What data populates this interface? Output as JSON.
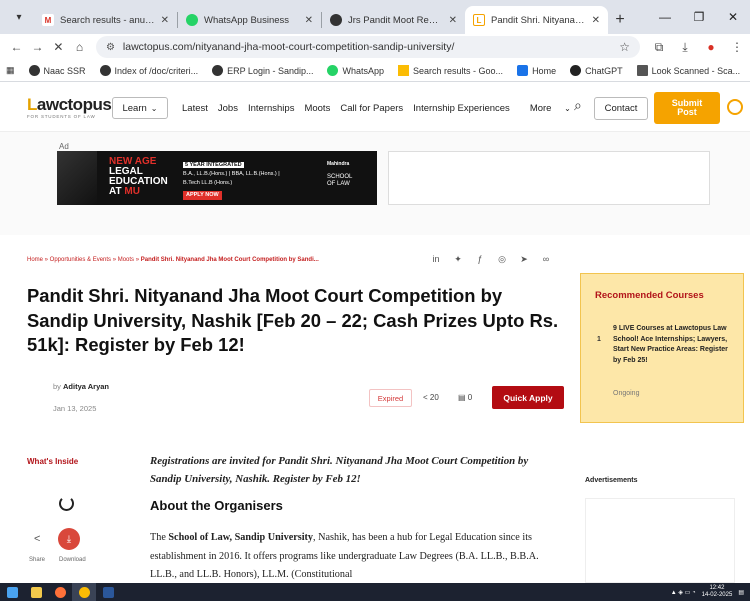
{
  "browser": {
    "tabs": [
      {
        "label": "Search results - anuja.nehe@s",
        "icon": "gmail-icon",
        "color": "#d93025"
      },
      {
        "label": "WhatsApp Business",
        "icon": "whatsapp-icon",
        "color": "#25d366"
      },
      {
        "label": "Jrs Pandit Moot Report",
        "icon": "doc-icon",
        "color": "#333333"
      },
      {
        "label": "Pandit Shri. Nityanand Jha Moo",
        "icon": "lawctopus-icon",
        "color": "#f5a300",
        "active": true
      }
    ],
    "url": "lawctopus.com/nityanand-jha-moot-court-competition-sandip-university/",
    "bookmarks": [
      {
        "label": "Naac SSR",
        "icon": "globe-icon",
        "color": "#333333"
      },
      {
        "label": "Index of /doc/criteri...",
        "icon": "globe-icon",
        "color": "#333333"
      },
      {
        "label": "ERP Login - Sandip...",
        "icon": "gear-icon",
        "color": "#333333"
      },
      {
        "label": "WhatsApp",
        "icon": "whatsapp-icon",
        "color": "#25d366"
      },
      {
        "label": "Search results - Goo...",
        "icon": "drive-icon",
        "color": "#fbbc04"
      },
      {
        "label": "Home",
        "icon": "home-icon",
        "color": "#1a73e8"
      },
      {
        "label": "ChatGPT",
        "icon": "chatgpt-icon",
        "color": "#222222"
      },
      {
        "label": "Look Scanned - Sca...",
        "icon": "scan-icon",
        "color": "#555555"
      },
      {
        "label": "M",
        "icon": "gmail-icon",
        "color": "#d93025"
      }
    ]
  },
  "site": {
    "logo_prefix": "L",
    "logo_rest": "awctopus",
    "logo_tag": "FOR STUDENTS OF LAW",
    "learn": "Learn",
    "nav": [
      "Latest",
      "Jobs",
      "Internships",
      "Moots",
      "Call for Papers",
      "Internship Experiences",
      "More"
    ],
    "contact": "Contact",
    "submit_line1": "Submit",
    "submit_line2": "Post"
  },
  "ad": {
    "label": "Ad",
    "line1": "NEW AGE",
    "line2": "LEGAL",
    "line3": "EDUCATION",
    "line4a": "AT ",
    "line4b": "MU",
    "badge": "5 YEAR INTEGRATED",
    "programs1": "B.A., LL.B.(Hons.) | BBA, LL.B.(Hons.) |",
    "programs2": "B.Tech LL.B (Hons.)",
    "apply": "APPLY NOW",
    "brand": "Mahindra",
    "school1": "SCHOOL",
    "school2": "OF LAW"
  },
  "article": {
    "breadcrumb_prefix": "Home » Opportunities & Events » Moots » ",
    "breadcrumb_current": "Pandit Shri. Nityanand Jha Moot Court Competition by Sandi...",
    "title": "Pandit Shri. Nityanand Jha Moot Court Competition by Sandip University, Nashik [Feb 20 – 22; Cash Prizes Upto Rs. 51k]: Register by Feb 12!",
    "by": "by ",
    "author": "Aditya Aryan",
    "date": "Jan 13, 2025",
    "status": "Expired",
    "shares": "20",
    "comments": "0",
    "cta": "Quick Apply",
    "whats_inside": "What's Inside",
    "share_label": "Share",
    "download_label": "Download",
    "lead": "Registrations are invited for Pandit Shri. Nityanand Jha Moot Court Competition by Sandip University, Nashik. Register by Feb 12!",
    "section_heading": "About the Organisers",
    "body_pre": "The ",
    "body_bold": "School of Law, Sandip University",
    "body_post": ", Nashik, has been a hub for Legal Education since its establishment in 2016. It offers programs like undergraduate Law Degrees (B.A. LL.B., B.B.A. LL.B., and LL.B. Honors), LL.M. (Constitutional"
  },
  "sidebar": {
    "rec_title": "Recommended Courses",
    "rec_num": "1",
    "rec_text": "9 LIVE Courses at Lawctopus Law School! Ace Internships; Lawyers, Start New Practice Areas: Register by Feb 25!",
    "rec_status": "Ongoing",
    "ads_title": "Advertisements"
  },
  "taskbar": {
    "time": "12:42",
    "date": "14-02-2025"
  }
}
